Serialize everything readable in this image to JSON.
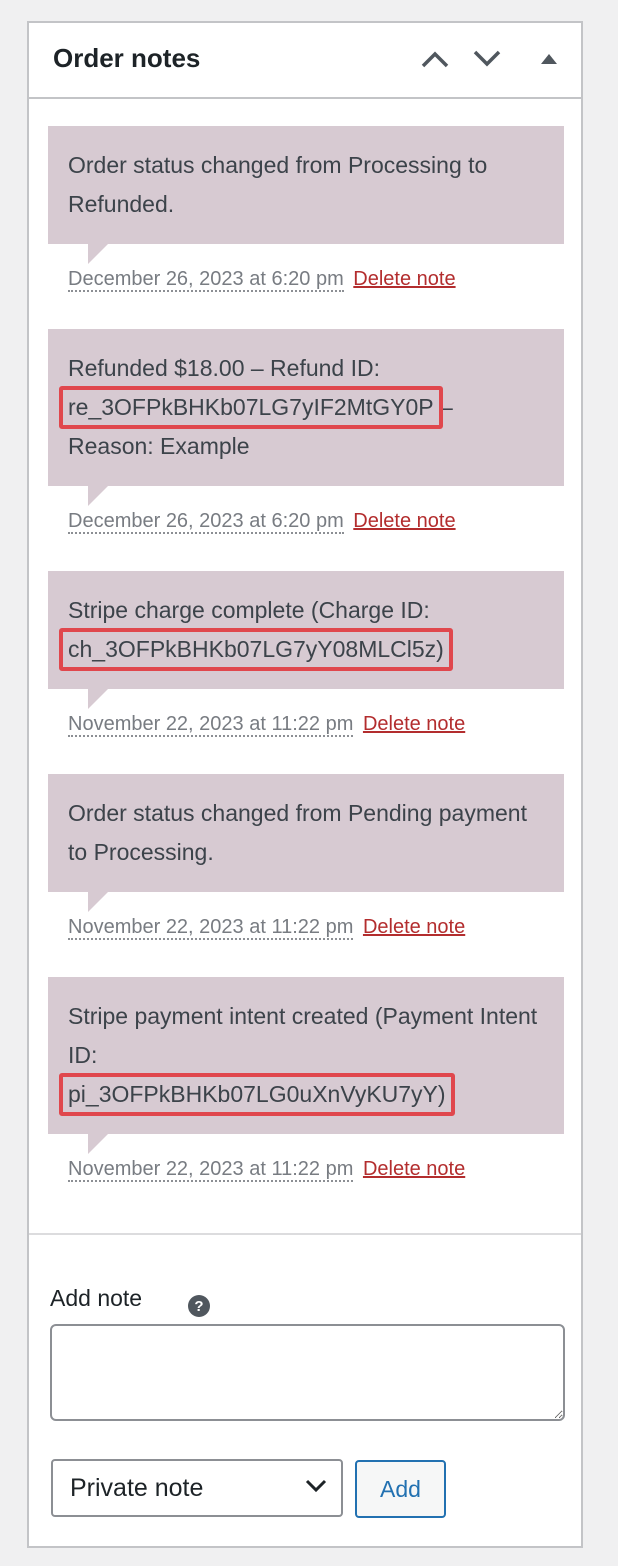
{
  "header": {
    "title": "Order notes"
  },
  "notes": [
    {
      "text_before": "Order status changed from Processing to Refunded.",
      "highlight": "",
      "text_after": "",
      "date": "December 26, 2023 at 6:20 pm",
      "delete_label": "Delete note"
    },
    {
      "text_before": "Refunded $18.00 – Refund ID:",
      "highlight": "re_3OFPkBHKb07LG7yIF2MtGY0P",
      "text_after": "– Reason: Example",
      "date": "December 26, 2023 at 6:20 pm",
      "delete_label": "Delete note"
    },
    {
      "text_before": "Stripe charge complete (Charge ID:",
      "highlight": "ch_3OFPkBHKb07LG7yY08MLCl5z)",
      "text_after": "",
      "date": "November 22, 2023 at 11:22 pm",
      "delete_label": "Delete note"
    },
    {
      "text_before": "Order status changed from Pending payment to Processing.",
      "highlight": "",
      "text_after": "",
      "date": "November 22, 2023 at 11:22 pm",
      "delete_label": "Delete note"
    },
    {
      "text_before": "Stripe payment intent created (Payment Intent ID:",
      "highlight": "pi_3OFPkBHKb07LG0uXnVyKU7yY)",
      "text_after": "",
      "date": "November 22, 2023 at 11:22 pm",
      "delete_label": "Delete note"
    }
  ],
  "add_note": {
    "label": "Add note",
    "help_icon": "?",
    "textarea_value": "",
    "note_type_selected": "Private note",
    "add_button": "Add"
  },
  "colors": {
    "note_bg": "#d7cad2",
    "highlight_border": "#e0474d",
    "delete_link": "#b32d2e",
    "button_accent": "#2271b1"
  }
}
